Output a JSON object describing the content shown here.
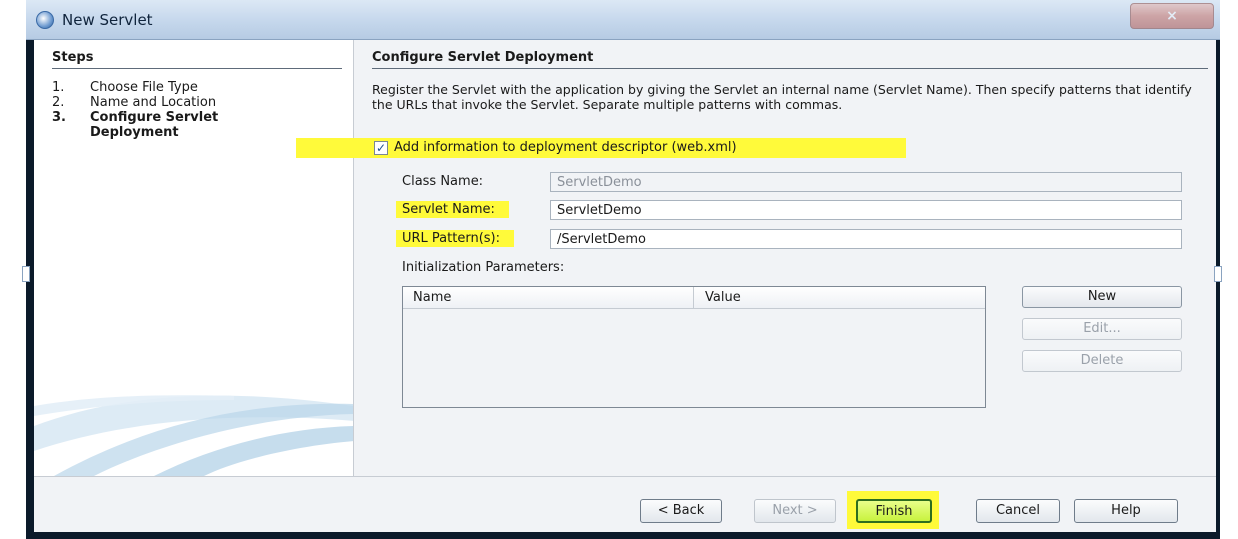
{
  "window": {
    "title": "New Servlet",
    "close_label": "×"
  },
  "steps": {
    "title": "Steps",
    "items": [
      {
        "num": "1.",
        "label": "Choose File Type"
      },
      {
        "num": "2.",
        "label": "Name and Location"
      },
      {
        "num": "3.",
        "label": "Configure Servlet Deployment"
      }
    ],
    "current_index": 3
  },
  "main": {
    "title": "Configure Servlet Deployment",
    "description": "Register the Servlet with the application by giving the Servlet an internal name (Servlet Name). Then specify patterns that identify the URLs that invoke the Servlet. Separate multiple patterns with commas.",
    "add_info_checkbox": {
      "label": "Add information to deployment descriptor (web.xml)",
      "checked": true
    },
    "class_name": {
      "label": "Class Name:",
      "value": "ServletDemo"
    },
    "servlet_name": {
      "label": "Servlet Name:",
      "value": "ServletDemo"
    },
    "url_pattern": {
      "label": "URL Pattern(s):",
      "value": "/ServletDemo"
    },
    "init_params": {
      "label": "Initialization Parameters:",
      "columns": [
        "Name",
        "Value"
      ],
      "rows": []
    },
    "buttons": {
      "new": "New",
      "edit": "Edit...",
      "delete": "Delete"
    }
  },
  "footer": {
    "back": "< Back",
    "next": "Next >",
    "finish": "Finish",
    "cancel": "Cancel",
    "help": "Help"
  },
  "colors": {
    "highlight": "#fffa3a",
    "panel": "#f1f3f6"
  }
}
